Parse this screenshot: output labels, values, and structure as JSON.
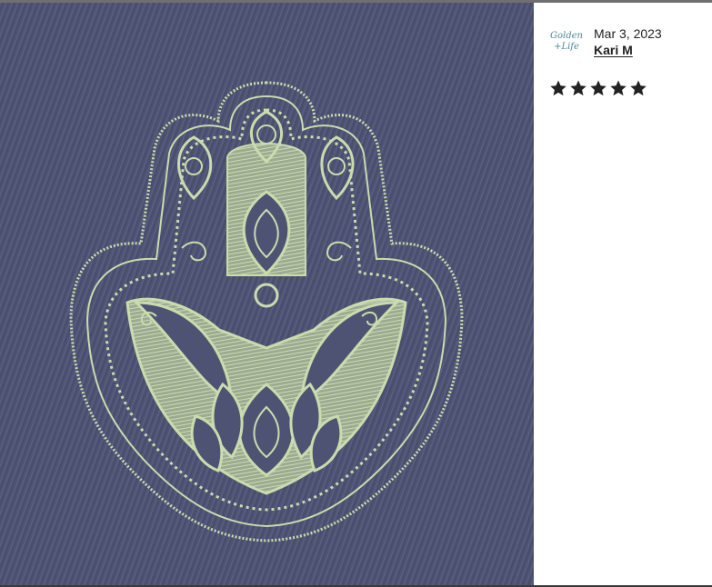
{
  "review": {
    "date": "Mar 3, 2023",
    "reviewer_name": "Kari M",
    "rating": 5,
    "rating_max": 5
  },
  "avatar": {
    "logo_text_line1": "Golden",
    "logo_text_line2": "+Life",
    "color": "#4b8a95"
  },
  "photo": {
    "subject": "embroidered hamsa hand",
    "fabric_color": "#4e5275",
    "thread_color": "#c9dcae"
  },
  "colors": {
    "star": "#222222",
    "text": "#222222"
  }
}
